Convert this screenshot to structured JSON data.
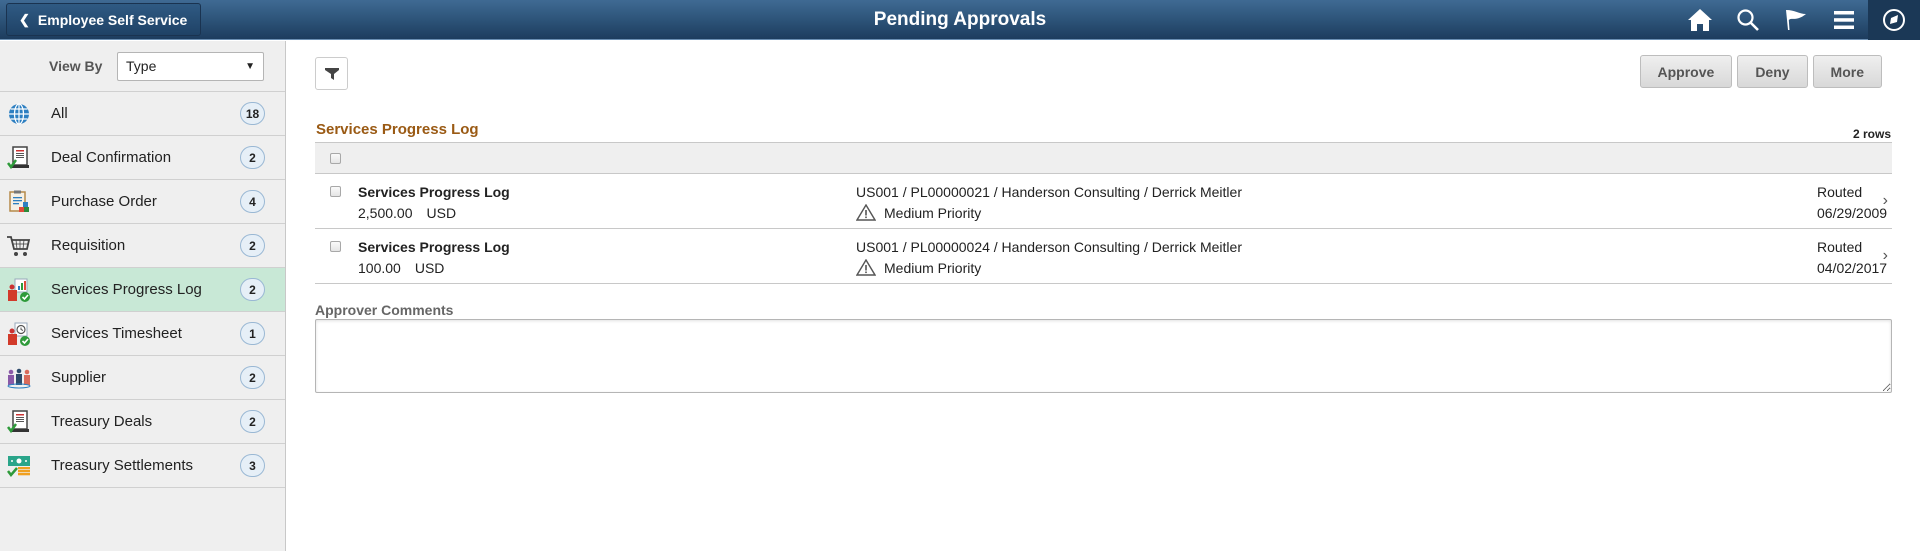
{
  "header": {
    "back_label": "Employee Self Service",
    "title": "Pending Approvals",
    "icons": [
      "home-icon",
      "search-icon",
      "flag-icon",
      "menu-icon",
      "navbar-compass-icon"
    ]
  },
  "sidebar": {
    "view_by_label": "View By",
    "view_by_value": "Type",
    "items": [
      {
        "label": "All",
        "count": "18",
        "icon": "globe-icon",
        "active": false
      },
      {
        "label": "Deal Confirmation",
        "count": "2",
        "icon": "deal-document-icon",
        "active": false
      },
      {
        "label": "Purchase Order",
        "count": "4",
        "icon": "clipboard-icon",
        "active": false
      },
      {
        "label": "Requisition",
        "count": "2",
        "icon": "cart-icon",
        "active": false
      },
      {
        "label": "Services Progress Log",
        "count": "2",
        "icon": "progress-log-icon",
        "active": true
      },
      {
        "label": "Services Timesheet",
        "count": "1",
        "icon": "timesheet-icon",
        "active": false
      },
      {
        "label": "Supplier",
        "count": "2",
        "icon": "supplier-people-icon",
        "active": false
      },
      {
        "label": "Treasury Deals",
        "count": "2",
        "icon": "treasury-document-icon",
        "active": false
      },
      {
        "label": "Treasury Settlements",
        "count": "3",
        "icon": "money-icon",
        "active": false
      }
    ]
  },
  "toolbar": {
    "approve_label": "Approve",
    "deny_label": "Deny",
    "more_label": "More"
  },
  "grid": {
    "title": "Services Progress Log",
    "row_count": "2 rows",
    "rows": [
      {
        "title": "Services Progress Log",
        "amount": "2,500.00",
        "currency": "USD",
        "details": "US001 / PL00000021 / Handerson Consulting / Derrick Meitler",
        "priority": "Medium Priority",
        "status": "Routed",
        "date": "06/29/2009"
      },
      {
        "title": "Services Progress Log",
        "amount": "100.00",
        "currency": "USD",
        "details": "US001 / PL00000024 / Handerson Consulting / Derrick Meitler",
        "priority": "Medium Priority",
        "status": "Routed",
        "date": "04/02/2017"
      }
    ]
  },
  "comments": {
    "label": "Approver Comments",
    "value": ""
  },
  "colors": {
    "header_bg": "#2d5479",
    "section_title": "#9a5a14",
    "active_item_bg": "#c8e8d6"
  }
}
